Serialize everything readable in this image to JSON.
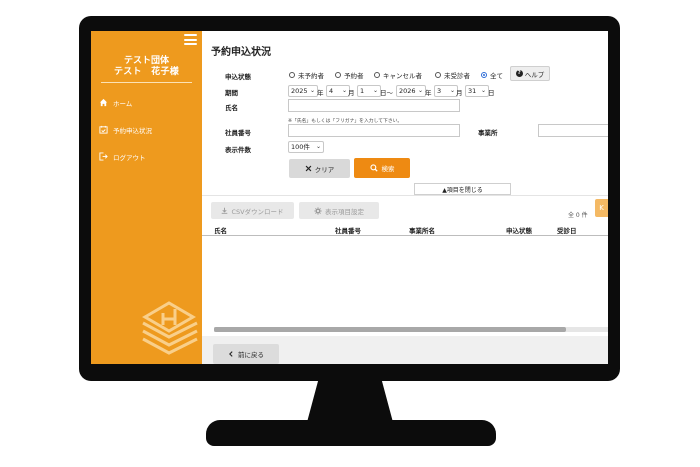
{
  "sidebar": {
    "org_name": "テスト団体",
    "user_name": "テスト　花子様",
    "items": [
      {
        "label": "ホーム",
        "icon": "home-icon"
      },
      {
        "label": "予約申込状況",
        "icon": "calendar-check-icon"
      },
      {
        "label": "ログアウト",
        "icon": "logout-icon"
      }
    ]
  },
  "page": {
    "title": "予約申込状況"
  },
  "form": {
    "status_label": "申込状態",
    "status_options": [
      "未予約者",
      "予約者",
      "キャンセル者",
      "未受診者",
      "全て"
    ],
    "status_selected": "全て",
    "help_label": "ヘルプ",
    "period_label": "期間",
    "from_year": "2025",
    "from_month": "4",
    "from_day": "1",
    "to_year": "2026",
    "to_month": "3",
    "to_day": "31",
    "unit_year": "年",
    "unit_month": "月",
    "unit_day": "日",
    "range_sep": "日〜",
    "name_label": "氏名",
    "name_value": "",
    "name_note": "※「氏名」もしくは「フリガナ」を入力して下さい。",
    "employee_no_label": "社員番号",
    "employee_no_value": "",
    "office_label": "事業所",
    "display_count_label": "表示件数",
    "display_count_value": "100件",
    "clear_label": "クリア",
    "search_label": "検索",
    "collapse_label": "▲項目を閉じる"
  },
  "toolbar": {
    "csv_label": "CSVダウンロード",
    "columns_label": "表示項目設定",
    "count_text": "全 0 件",
    "stub_glyph": "K"
  },
  "table": {
    "columns": [
      "氏名",
      "社員番号",
      "事業所名",
      "申込状態",
      "受診日"
    ]
  },
  "footer": {
    "back_label": "前に戻る"
  },
  "colors": {
    "accent": "#ee9a1e",
    "search_button": "#ee8a12"
  }
}
